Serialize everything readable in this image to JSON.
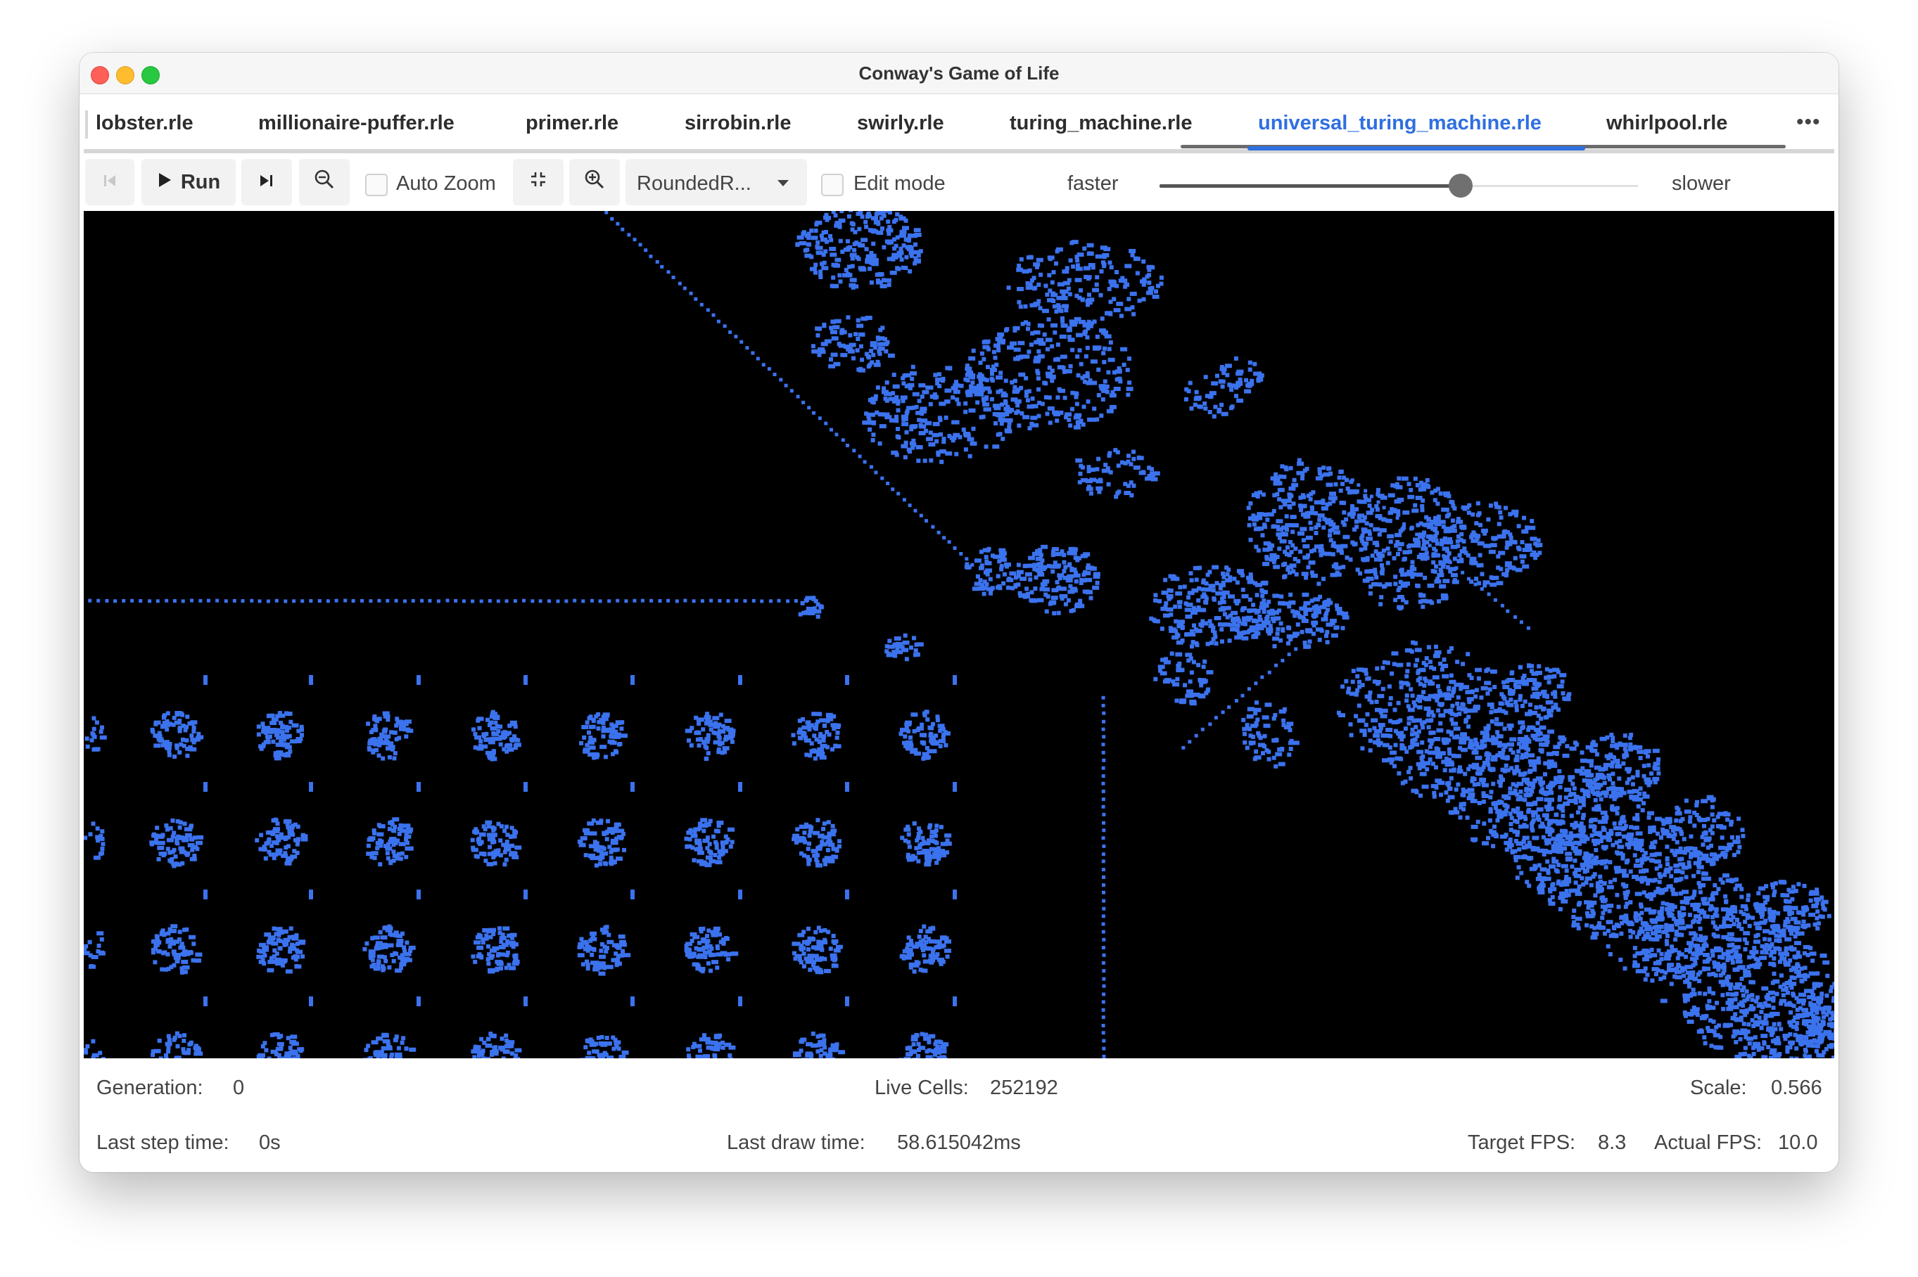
{
  "window": {
    "title": "Conway's Game of Life"
  },
  "tabs": [
    {
      "label": "lobster.rle",
      "active": false
    },
    {
      "label": "millionaire-puffer.rle",
      "active": false
    },
    {
      "label": "primer.rle",
      "active": false
    },
    {
      "label": "sirrobin.rle",
      "active": false
    },
    {
      "label": "swirly.rle",
      "active": false
    },
    {
      "label": "turing_machine.rle",
      "active": false
    },
    {
      "label": "universal_turing_machine.rle",
      "active": true
    },
    {
      "label": "whirlpool.rle",
      "active": false
    }
  ],
  "tab_overflow_icon": "more-horizontal-icon",
  "toolbar": {
    "reset_icon": "skip-to-start-icon",
    "run_label": "Run",
    "run_icon": "play-icon",
    "step_icon": "step-forward-icon",
    "zoom_out_icon": "zoom-out-icon",
    "auto_zoom_label": "Auto Zoom",
    "auto_zoom_checked": false,
    "fit_icon": "fit-to-view-icon",
    "zoom_in_icon": "zoom-in-icon",
    "renderer_value": "RoundedR...",
    "edit_mode_label": "Edit mode",
    "edit_mode_checked": false,
    "faster_label": "faster",
    "slower_label": "slower",
    "speed_slider_fraction": 0.63
  },
  "status": {
    "generation_label": "Generation:",
    "generation_value": "0",
    "live_cells_label": "Live Cells:",
    "live_cells_value": "252192",
    "scale_label": "Scale:",
    "scale_value": "0.566",
    "last_step_label": "Last step time:",
    "last_step_value": "0s",
    "last_draw_label": "Last draw time:",
    "last_draw_value": "58.615042ms",
    "target_fps_label": "Target FPS:",
    "target_fps_value": "8.3",
    "actual_fps_label": "Actual FPS:",
    "actual_fps_value": "10.0"
  },
  "colors": {
    "accent": "#2f6fe0",
    "cell": "#3b72ee",
    "canvas_background": "#000000"
  }
}
